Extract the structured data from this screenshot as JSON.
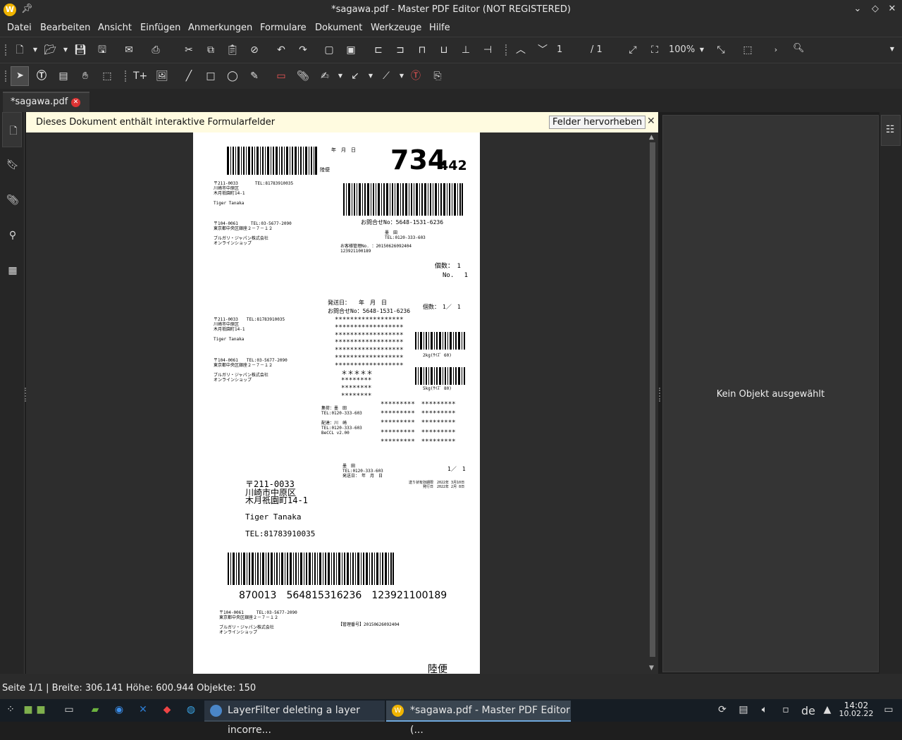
{
  "window": {
    "title": "*sagawa.pdf - Master PDF Editor (NOT REGISTERED)",
    "app_icon_letter": "W"
  },
  "menu": [
    "Datei",
    "Bearbeiten",
    "Ansicht",
    "Einfügen",
    "Anmerkungen",
    "Formulare",
    "Dokument",
    "Werkzeuge",
    "Hilfe"
  ],
  "toolbar": {
    "page_current": "1",
    "page_total": "/ 1",
    "zoom": "100%"
  },
  "tabs": [
    {
      "label": "*sagawa.pdf"
    }
  ],
  "infobar": {
    "message": "Dieses Dokument enthält interaktive Formularfelder",
    "highlight_button": "Felder hervorheben",
    "close": "✕"
  },
  "right_panel": {
    "message": "Kein Objekt ausgewählt"
  },
  "status": {
    "text": "Seite 1/1 | Breite: 306.141 Höhe: 600.944 Objekte: 150"
  },
  "pdf": {
    "date_label": "年　月　日",
    "rikubin": "陸便",
    "big_num": "734",
    "small_num": "442",
    "sender1": "〒211-0033　　　　TEL:81783910035\n川崎市中原区\n木月祇園町14-1\n\nTiger Tanaka",
    "receiver1": "〒104-0061　　　TEL:03-5677-2090\n東京都中央区銀座２－７－１２\n\nブルガリ・ジャパン株式会社\nオンラインショップ",
    "inquiry": "お問合せNo：5648-1531-6236",
    "office": "墨　田\nTEL:0120-333-603",
    "customer_no": "お客様管理No. ：20150626092404\n123921100189",
    "count": "個数：　1",
    "no": "No.　 1",
    "ship_date": "発送日：　　年　月　日",
    "inquiry2": "お問合せNo：5648-1531-6236",
    "count2": "個数：　1／　1",
    "stars": "******************\n******************\n******************\n******************\n******************\n******************\n******************\n　＊＊＊＊＊\n　********\n　********\n　********",
    "weight1": "2kg(ｻｲｽﾞ 60)",
    "weight2": "5kg(ｻｲｽﾞ 80)",
    "sender2": "〒211-0033　　TEL:81783910035\n川崎市中原区\n木月祇園町14-1\n\nTiger Tanaka",
    "receiver2": "〒104-0061　　TEL:03-5677-2090\n東京都中央区銀座２－７－１２\n\nブルガリ・ジャパン株式会社\nオンラインショップ",
    "collect": "集荷：墨　田\nTEL:0120-333-603\n\n配達：川　崎\nTEL:0120-333-603\nBeCCL v2.00",
    "stars_grid": "*********　*********\n*********　*********\n*********　*********\n*********　*********\n*********　*********",
    "office2": "墨　田\nTEL:0120-333-603\n発送日：　年　月　日",
    "fraction": "1／　1",
    "validity": "送り状有効期限　2022年 3月10日\n　　　　発行日　2022年 2月 8日",
    "addr_big": "〒211-0033\n川崎市中原区\n木月祇園町14-1",
    "name_big": "Tiger Tanaka",
    "tel_big": "TEL:81783910035",
    "barcode_num": "870013　564815316236　123921100189",
    "receiver3": "〒104-0061　　　TEL:03-5677-2090\n東京都中央区銀座２－７－１２\n\nブルガリ・ジャパン株式会社\nオンラインショップ",
    "mgmt": "【管理番号】20150626092404",
    "rikubin_bottom": "陸便"
  },
  "taskbar": {
    "task1": "LayerFilter deleting a layer incorre...",
    "task2": "*sagawa.pdf - Master PDF Editor (...",
    "lang": "de",
    "time": "14:02",
    "date": "10.02.22"
  }
}
